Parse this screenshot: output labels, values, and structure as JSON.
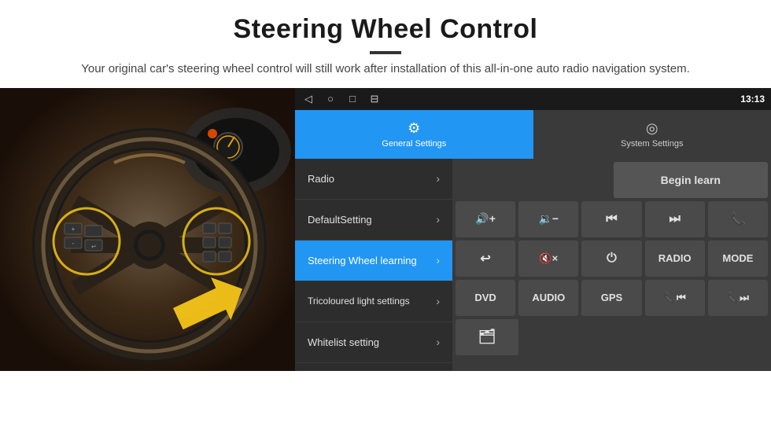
{
  "header": {
    "title": "Steering Wheel Control",
    "description": "Your original car's steering wheel control will still work after installation of this all-in-one auto radio navigation system."
  },
  "status_bar": {
    "time": "13:13",
    "nav_buttons": [
      "◁",
      "○",
      "□",
      "⊟"
    ]
  },
  "tabs": [
    {
      "id": "general",
      "label": "General Settings",
      "icon": "⚙",
      "active": true
    },
    {
      "id": "system",
      "label": "System Settings",
      "icon": "◎",
      "active": false
    }
  ],
  "menu_items": [
    {
      "id": "radio",
      "label": "Radio",
      "active": false
    },
    {
      "id": "default",
      "label": "DefaultSetting",
      "active": false
    },
    {
      "id": "steering",
      "label": "Steering Wheel learning",
      "active": true
    },
    {
      "id": "tricoloured",
      "label": "Tricoloured light settings",
      "active": false
    },
    {
      "id": "whitelist",
      "label": "Whitelist setting",
      "active": false
    }
  ],
  "controls": {
    "begin_learn": "Begin learn",
    "row1": [
      {
        "id": "vol-up",
        "icon": "🔊+",
        "label": "🔊+"
      },
      {
        "id": "vol-down",
        "icon": "🔉-",
        "label": "🔉-"
      },
      {
        "id": "prev-track",
        "icon": "⏮",
        "label": "⏮"
      },
      {
        "id": "next-track",
        "icon": "⏭",
        "label": "⏭"
      },
      {
        "id": "phone",
        "icon": "📞",
        "label": "📞"
      }
    ],
    "row2": [
      {
        "id": "hang-up",
        "icon": "↩",
        "label": "↩"
      },
      {
        "id": "mute",
        "icon": "🔇x",
        "label": "🔇×"
      },
      {
        "id": "power",
        "icon": "⏻",
        "label": "⏻"
      },
      {
        "id": "radio-btn",
        "label": "RADIO"
      },
      {
        "id": "mode-btn",
        "label": "MODE"
      }
    ],
    "row3": [
      {
        "id": "dvd-btn",
        "label": "DVD"
      },
      {
        "id": "audio-btn",
        "label": "AUDIO"
      },
      {
        "id": "gps-btn",
        "label": "GPS"
      },
      {
        "id": "tel-prev",
        "icon": "📞⏮",
        "label": "📞⏮"
      },
      {
        "id": "tel-next",
        "icon": "📞⏭",
        "label": "📞⏭"
      }
    ],
    "row4": [
      {
        "id": "folder-btn",
        "icon": "📁",
        "label": "📁"
      }
    ]
  }
}
